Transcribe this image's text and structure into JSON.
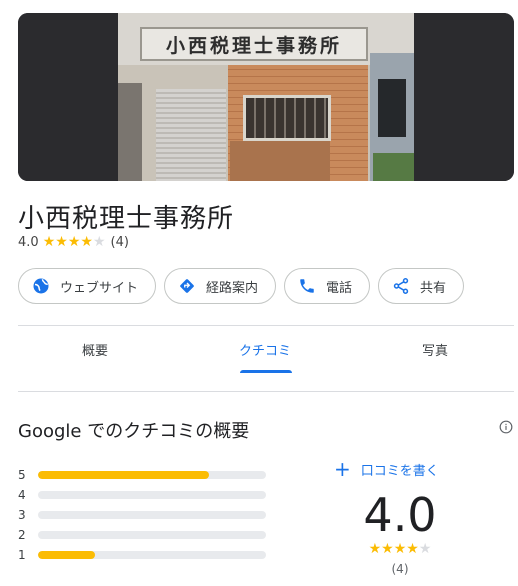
{
  "photo": {
    "sign_text": "小西税理士事務所"
  },
  "place": {
    "name": "小西税理士事務所",
    "rating": "4.0",
    "review_count": "(4)",
    "stars_filled": 4,
    "stars_total": 5
  },
  "actions": [
    {
      "label": "ウェブサイト",
      "icon": "globe-icon"
    },
    {
      "label": "経路案内",
      "icon": "directions-icon"
    },
    {
      "label": "電話",
      "icon": "phone-icon"
    },
    {
      "label": "共有",
      "icon": "share-icon"
    }
  ],
  "tabs": [
    {
      "label": "概要",
      "active": false
    },
    {
      "label": "クチコミ",
      "active": true
    },
    {
      "label": "写真",
      "active": false
    }
  ],
  "summary": {
    "title": "Google でのクチコミの概要",
    "write_review_label": "口コミを書く",
    "score": "4.0",
    "count": "(4)",
    "distribution": [
      {
        "stars": "5",
        "fraction": 0.75
      },
      {
        "stars": "4",
        "fraction": 0
      },
      {
        "stars": "3",
        "fraction": 0
      },
      {
        "stars": "2",
        "fraction": 0
      },
      {
        "stars": "1",
        "fraction": 0.25
      }
    ]
  },
  "colors": {
    "accent": "#1a73e8",
    "star": "#fbbc04",
    "track": "#e8eaed"
  }
}
